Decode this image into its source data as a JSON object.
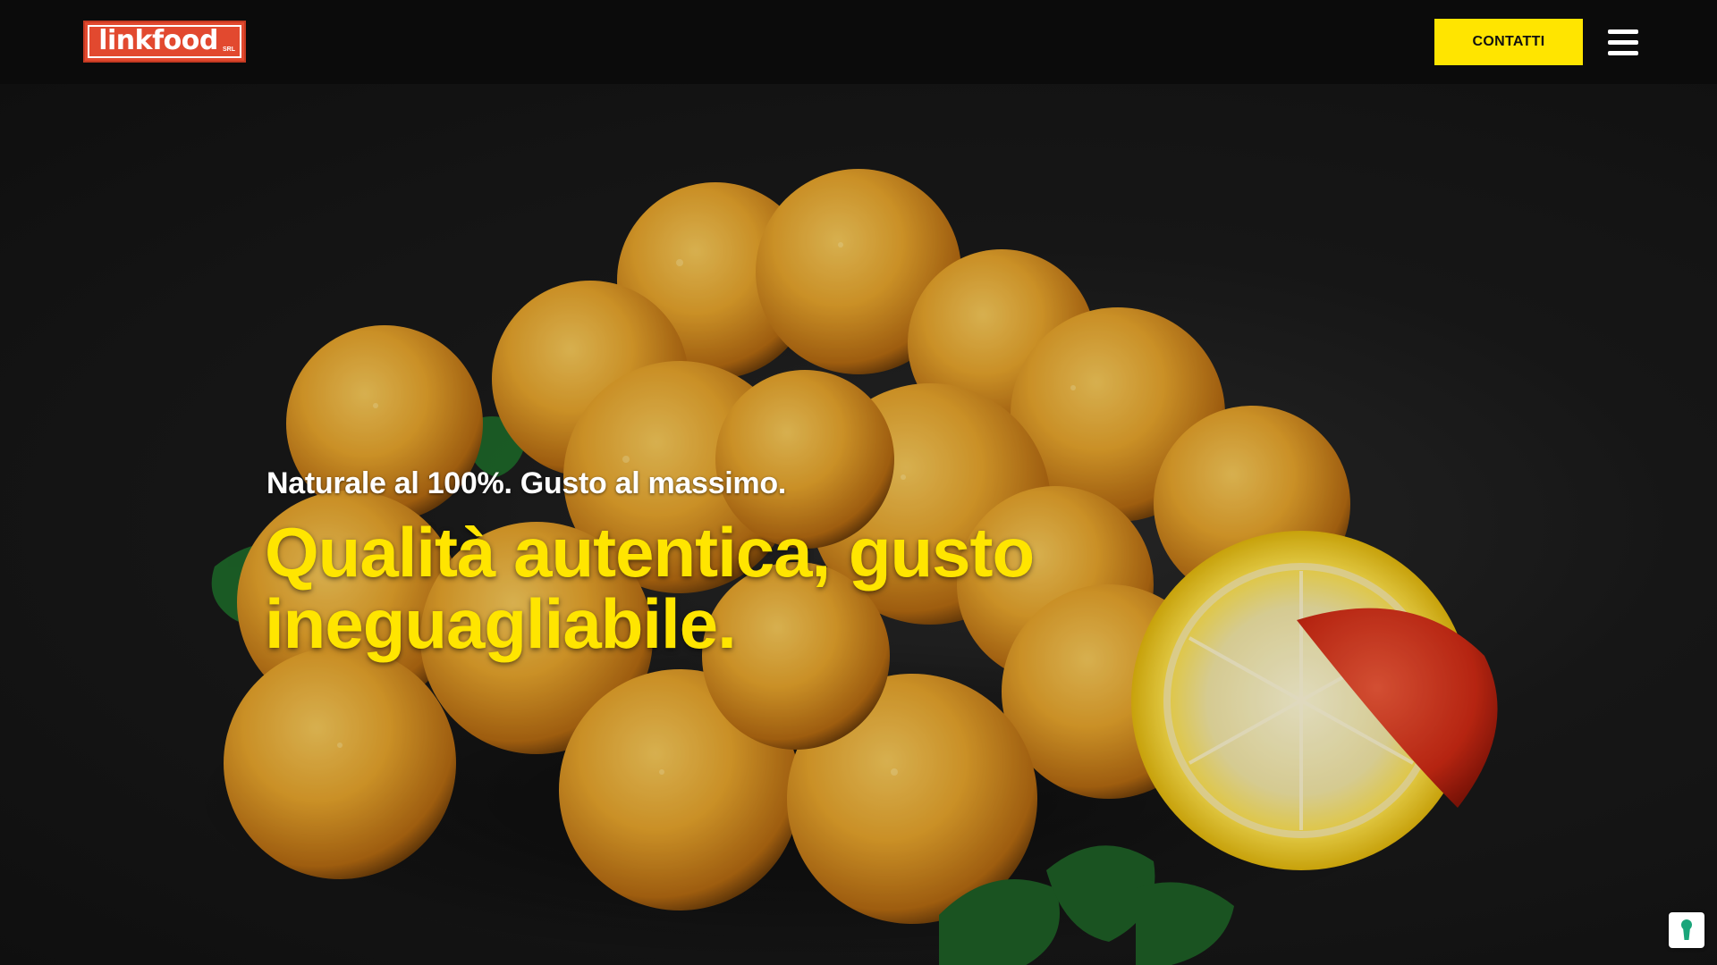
{
  "header": {
    "logo_text": "linkfood",
    "logo_suffix": "SRL",
    "contact_label": "CONTATTI"
  },
  "hero": {
    "subtitle": "Naturale al 100%. Gusto al massimo.",
    "title": "Qualità autentica, gusto ineguagliabile."
  },
  "colors": {
    "header_bg": "#0b0b0b",
    "accent_yellow": "#ffe500",
    "logo_red": "#e2492f",
    "lock_green": "#1aa57a"
  },
  "icons": {
    "menu": "hamburger-menu-icon",
    "privacy": "keyhole-lock-icon"
  }
}
